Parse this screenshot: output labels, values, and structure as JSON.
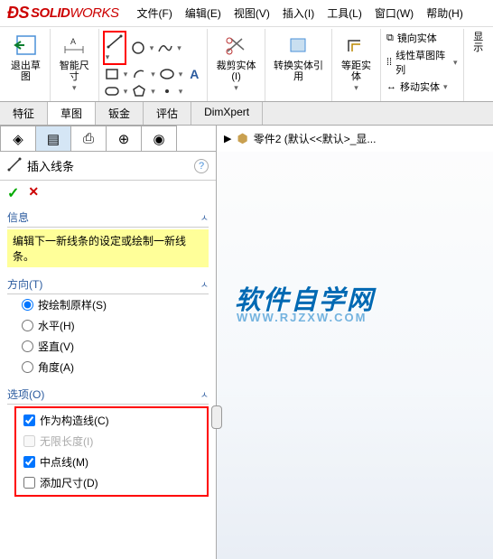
{
  "app": {
    "name_solid": "SOLID",
    "name_works": "WORKS"
  },
  "menu": {
    "file": "文件(F)",
    "edit": "编辑(E)",
    "view": "视图(V)",
    "insert": "插入(I)",
    "tools": "工具(L)",
    "window": "窗口(W)",
    "help": "帮助(H)"
  },
  "ribbon": {
    "exit_sketch": "退出草图",
    "smart_dim": "智能尺寸",
    "trim": "裁剪实体(I)",
    "convert": "转换实体引用",
    "equidist": "等距实体",
    "mirror": "镜向实体",
    "pattern": "线性草图阵列",
    "move": "移动实体",
    "display": "显示"
  },
  "tabs": {
    "feature": "特征",
    "sketch": "草图",
    "sheetmetal": "钣金",
    "evaluate": "评估",
    "dimxpert": "DimXpert"
  },
  "tree": {
    "part": "零件2  (默认<<默认>_显..."
  },
  "panel": {
    "title": "插入线条",
    "info_head": "信息",
    "info_body": "编辑下一新线条的设定或绘制一新线条。",
    "direction_head": "方向(T)",
    "dir_asdrawn": "按绘制原样(S)",
    "dir_horiz": "水平(H)",
    "dir_vert": "竖直(V)",
    "dir_angle": "角度(A)",
    "options_head": "选项(O)",
    "opt_construction": "作为构造线(C)",
    "opt_infinite": "无限长度(I)",
    "opt_midpoint": "中点线(M)",
    "opt_adddim": "添加尺寸(D)"
  },
  "watermark": {
    "main": "软件自学网",
    "sub": "WWW.RJZXW.COM"
  }
}
